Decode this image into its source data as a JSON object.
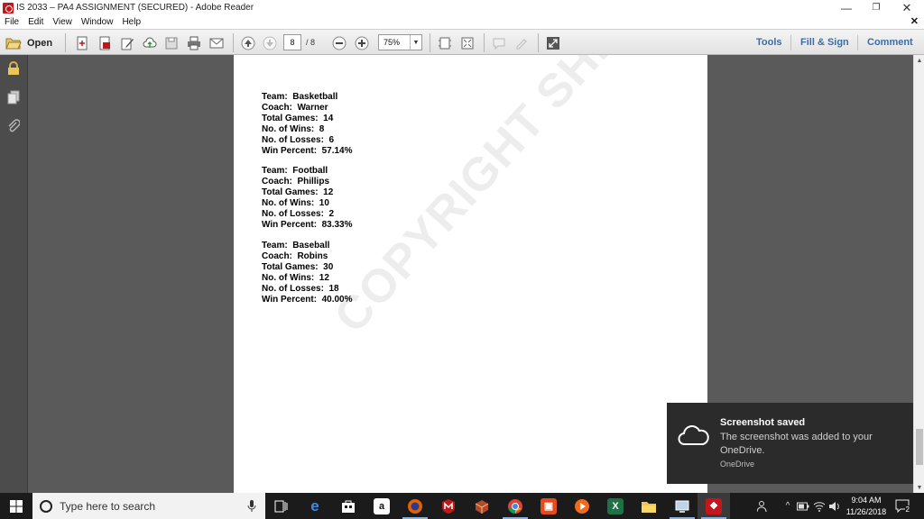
{
  "window": {
    "title": "IS 2033 – PA4 ASSIGNMENT (SECURED) - Adobe Reader"
  },
  "menu": {
    "items": [
      "File",
      "Edit",
      "View",
      "Window",
      "Help"
    ]
  },
  "toolbar": {
    "open_label": "Open",
    "page_current": "8",
    "page_total": "/ 8",
    "zoom": "75%",
    "tools_label": "Tools",
    "fill_sign_label": "Fill & Sign",
    "comment_label": "Comment"
  },
  "document": {
    "watermark": "COPYRIGHT SHEPHERD",
    "teams": [
      {
        "team": "Team:  Basketball",
        "coach": "Coach:  Warner",
        "games": "Total Games:  14",
        "wins": "No. of Wins:  8",
        "losses": "No. of Losses:  6",
        "percent": "Win Percent:  57.14%"
      },
      {
        "team": "Team:  Football",
        "coach": "Coach:  Phillips",
        "games": "Total Games:  12",
        "wins": "No. of Wins:  10",
        "losses": "No. of Losses:  2",
        "percent": "Win Percent:  83.33%"
      },
      {
        "team": "Team:  Baseball",
        "coach": "Coach:  Robins",
        "games": "Total Games:  30",
        "wins": "No. of Wins:  12",
        "losses": "No. of Losses:  18",
        "percent": "Win Percent:  40.00%"
      }
    ]
  },
  "toast": {
    "title": "Screenshot saved",
    "body": "The screenshot was added to your OneDrive.",
    "source": "OneDrive"
  },
  "taskbar": {
    "search_placeholder": "Type here to search",
    "time": "9:04 AM",
    "date": "11/26/2018",
    "notification_count": "2"
  },
  "colors": {
    "accent_link": "#3b6ea8",
    "reader_red": "#c4161c",
    "doc_background": "#5a5a5a",
    "taskbar": "#1b1b1b"
  }
}
